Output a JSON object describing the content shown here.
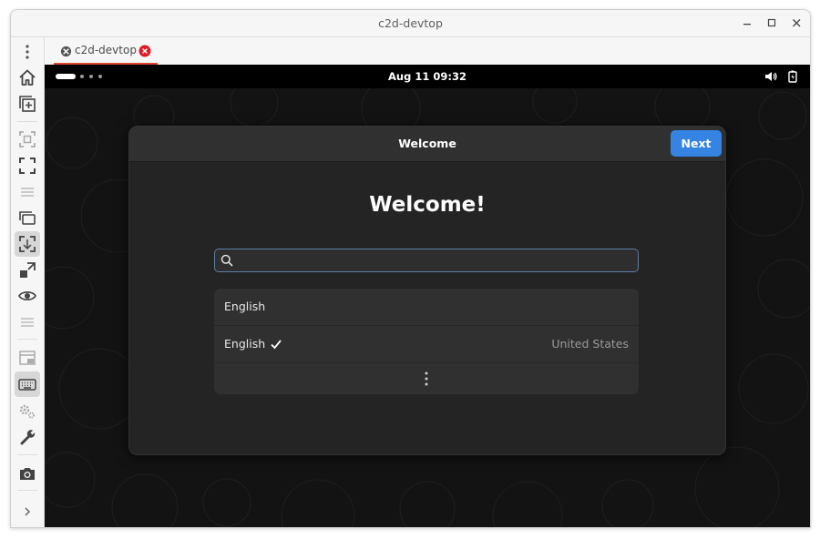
{
  "window": {
    "title": "c2d-devtop"
  },
  "tabs": [
    {
      "label": "c2d-devtop",
      "active": true
    }
  ],
  "sidebar": {
    "items": [
      {
        "icon": "more-vertical-icon"
      },
      {
        "icon": "home-icon"
      },
      {
        "icon": "new-window-icon"
      },
      {
        "icon": "fit-screen-icon"
      },
      {
        "icon": "fullscreen-icon"
      },
      {
        "icon": "menu-icon"
      },
      {
        "icon": "window-stack-icon"
      },
      {
        "icon": "scale-icon",
        "active": true
      },
      {
        "icon": "resize-icon"
      },
      {
        "icon": "eye-icon"
      },
      {
        "icon": "menu-icon"
      },
      {
        "icon": "picture-in-picture-icon"
      },
      {
        "icon": "keyboard-icon",
        "active": true
      },
      {
        "icon": "gears-icon"
      },
      {
        "icon": "wrench-icon"
      },
      {
        "icon": "camera-icon"
      },
      {
        "icon": "chevron-right-icon"
      }
    ]
  },
  "remote": {
    "topbar": {
      "clock": "Aug 11  09:32"
    },
    "dialog": {
      "title": "Welcome",
      "next_label": "Next",
      "heading": "Welcome!",
      "search": {
        "value": "",
        "placeholder": ""
      },
      "languages": [
        {
          "name": "English",
          "region": "",
          "selected": false
        },
        {
          "name": "English",
          "region": "United States",
          "selected": true
        }
      ]
    }
  },
  "colors": {
    "accent": "#3584e4",
    "tab_underline": "#e0452e",
    "close_badge": "#e01b24",
    "dialog_bg": "#242424",
    "header_bg": "#303030"
  }
}
